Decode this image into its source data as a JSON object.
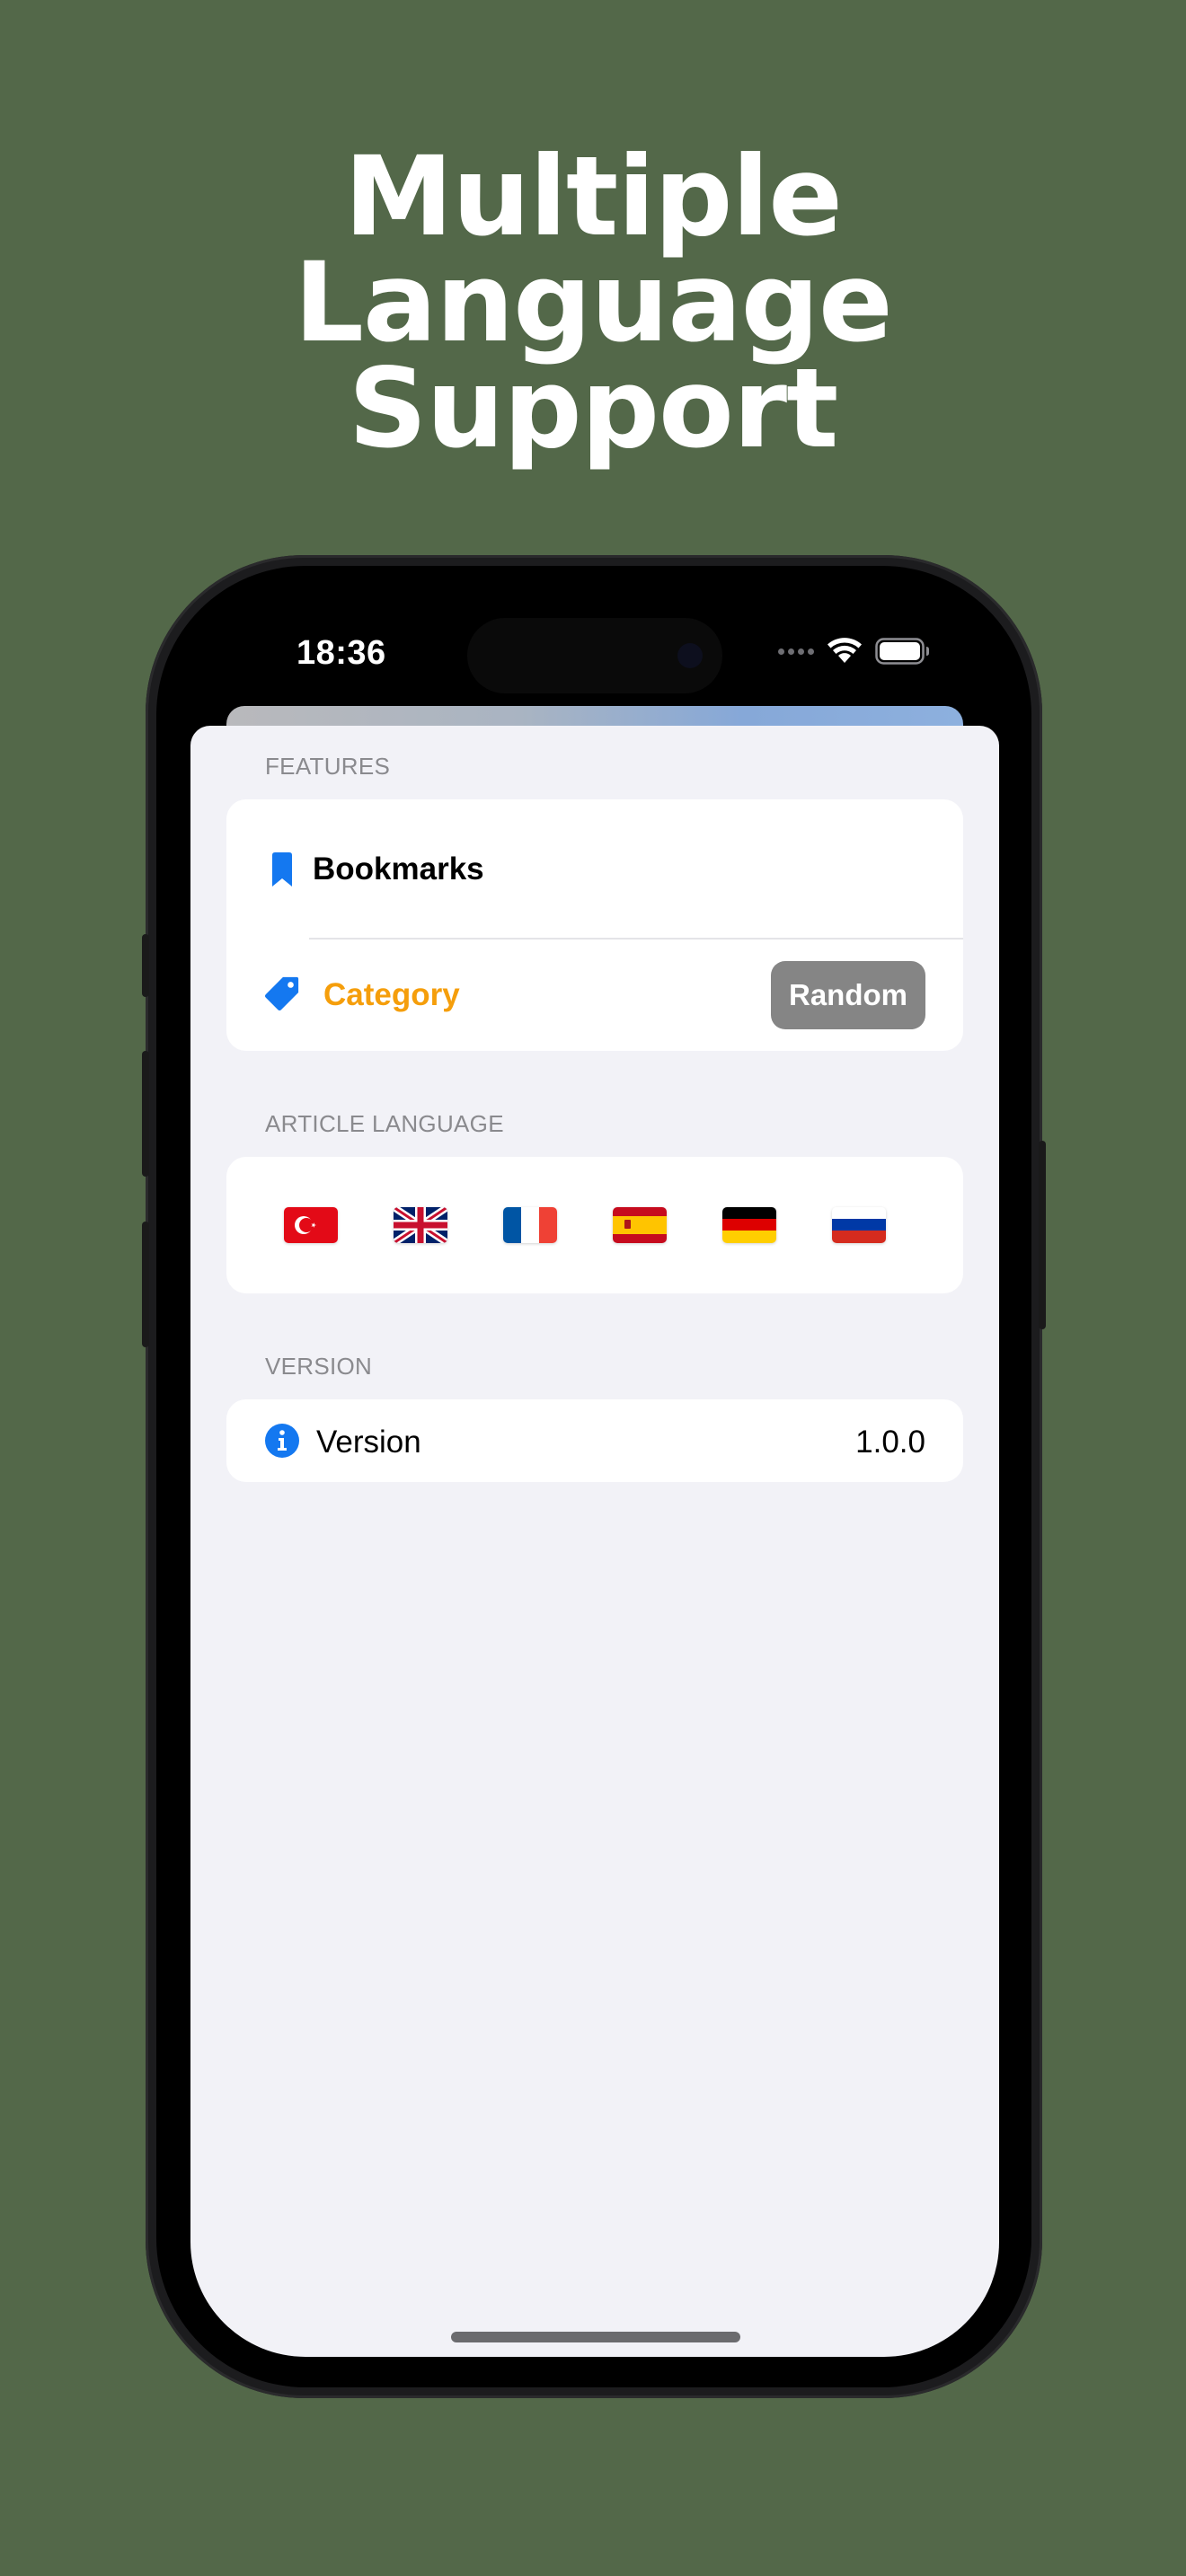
{
  "headline": {
    "line1": "Multiple",
    "line2": "Language",
    "line3": "Support"
  },
  "status_bar": {
    "time": "18:36",
    "icons": [
      "cellular-signal-icon",
      "wifi-icon",
      "battery-icon"
    ]
  },
  "features": {
    "header": "FEATURES",
    "bookmarks_label": "Bookmarks",
    "bookmarks_icon": "bookmark-icon",
    "category_label": "Category",
    "category_icon": "tag-icon",
    "random_label": "Random"
  },
  "article_language": {
    "header": "ARTICLE LANGUAGE",
    "flags": [
      "turkey-flag-icon",
      "uk-flag-icon",
      "france-flag-icon",
      "spain-flag-icon",
      "germany-flag-icon",
      "russia-flag-icon"
    ]
  },
  "version": {
    "header": "VERSION",
    "label": "Version",
    "value": "1.0.0",
    "icon": "info-icon"
  },
  "colors": {
    "background": "#536849",
    "accent_blue": "#1478f0",
    "accent_orange": "#f59e0b",
    "random_button": "#858585",
    "sheet_bg": "#f2f2f7"
  }
}
